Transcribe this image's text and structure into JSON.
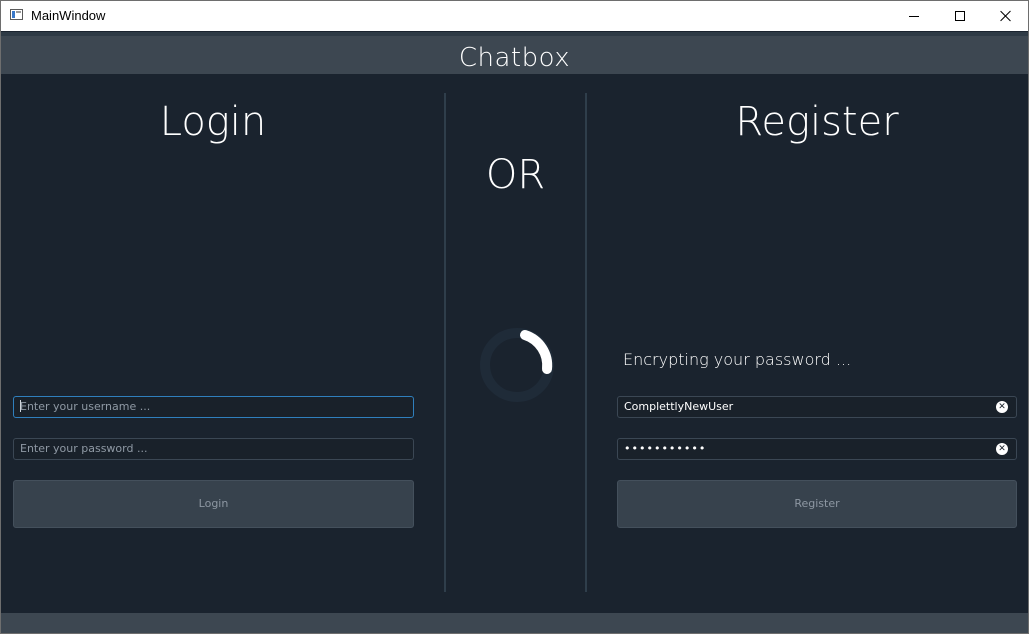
{
  "window": {
    "title": "MainWindow"
  },
  "header": {
    "title": "Chatbox"
  },
  "login": {
    "heading": "Login",
    "username_placeholder": "Enter your username ...",
    "password_placeholder": "Enter your password ...",
    "button_label": "Login"
  },
  "separator": {
    "text": "OR"
  },
  "register": {
    "heading": "Register",
    "status": "Encrypting your password ...",
    "username_value": "ComplettlyNewUser",
    "password_mask": "•••••••••••",
    "clear_glyph": "✕",
    "button_label": "Register"
  },
  "icons": {
    "app": "app-window-icon",
    "minimize": "minimize-icon",
    "maximize": "maximize-icon",
    "close": "close-icon",
    "spinner": "loading-spinner-icon",
    "clear": "clear-field-icon"
  },
  "colors": {
    "background": "#1a232e",
    "header": "#3d4751",
    "accent_focus": "#2f7fbd",
    "button": "#37424d",
    "text": "#ffffff"
  }
}
